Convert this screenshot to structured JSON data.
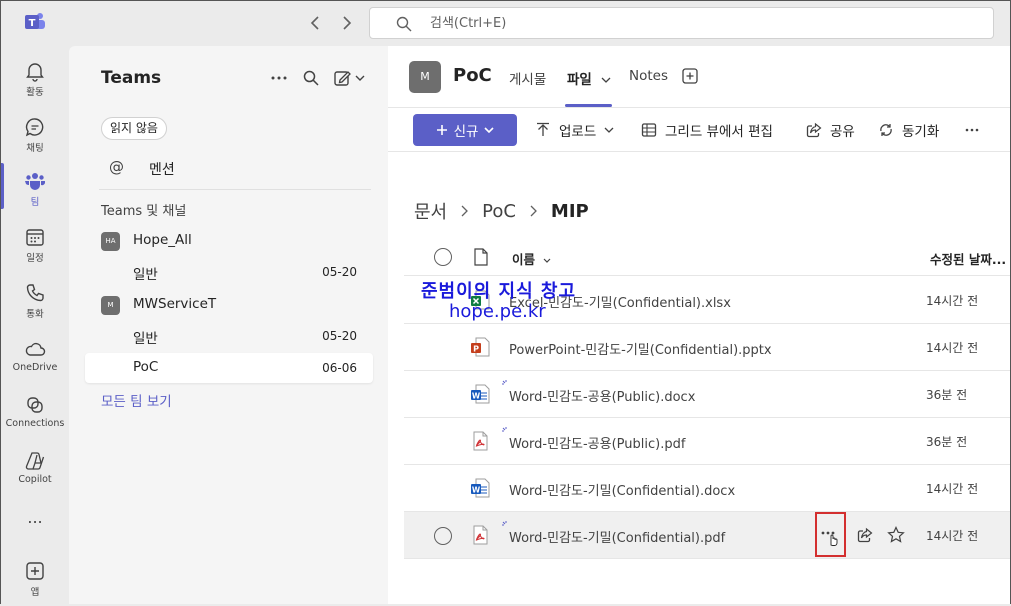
{
  "titlebar": {
    "search_placeholder": "검색(Ctrl+E)"
  },
  "rail": {
    "items": [
      {
        "label": "활동",
        "icon": "bell-icon"
      },
      {
        "label": "채팅",
        "icon": "chat-icon"
      },
      {
        "label": "팀",
        "icon": "teams-icon"
      },
      {
        "label": "일정",
        "icon": "calendar-icon"
      },
      {
        "label": "통화",
        "icon": "phone-icon"
      },
      {
        "label": "OneDrive",
        "icon": "cloud-icon"
      },
      {
        "label": "Connections",
        "icon": "connections-icon"
      },
      {
        "label": "Copilot",
        "icon": "copilot-icon"
      },
      {
        "label": "앱",
        "icon": "add-app-icon"
      }
    ],
    "more_label": "..."
  },
  "pane": {
    "title": "Teams",
    "unread_filter": "읽지 않음",
    "mention_label": "멘션",
    "section_label": "Teams 및 채널",
    "teams": [
      {
        "initials": "HA",
        "name": "Hope_All",
        "channels": [
          {
            "name": "일반",
            "date": "05-20"
          }
        ]
      },
      {
        "initials": "M",
        "name": "MWServiceT",
        "channels": [
          {
            "name": "일반",
            "date": "05-20"
          },
          {
            "name": "PoC",
            "date": "06-06"
          }
        ]
      }
    ],
    "all_teams_link": "모든 팀 보기"
  },
  "channel": {
    "initial": "M",
    "name": "PoC",
    "tabs": [
      "게시물",
      "파일",
      "Notes"
    ],
    "active_tab": "파일"
  },
  "toolbar": {
    "new_label": "신규",
    "upload_label": "업로드",
    "grid_edit_label": "그리드 뷰에서 편집",
    "share_label": "공유",
    "sync_label": "동기화"
  },
  "breadcrumb": [
    "문서",
    "PoC",
    "MIP"
  ],
  "columns": {
    "name": "이름",
    "modified": "수정된 날짜..."
  },
  "files": [
    {
      "name": "Excel-민감도-기밀(Confidential).xlsx",
      "type": "excel",
      "modified": "14시간 전"
    },
    {
      "name": "PowerPoint-민감도-기밀(Confidential).pptx",
      "type": "powerpoint",
      "modified": "14시간 전"
    },
    {
      "name": "Word-민감도-공용(Public).docx",
      "type": "word",
      "modified": "36분 전"
    },
    {
      "name": "Word-민감도-공용(Public).pdf",
      "type": "pdf",
      "modified": "36분 전"
    },
    {
      "name": "Word-민감도-기밀(Confidential).docx",
      "type": "word",
      "modified": "14시간 전"
    },
    {
      "name": "Word-민감도-기밀(Confidential).pdf",
      "type": "pdf",
      "modified": "14시간 전"
    }
  ],
  "watermark": {
    "line1": "준범이의 지식 창고",
    "line2": "hope.pe.kr"
  },
  "colors": {
    "accent": "#5b5fc7",
    "highlight": "#d32f2f",
    "watermark": "#1a1adb"
  }
}
